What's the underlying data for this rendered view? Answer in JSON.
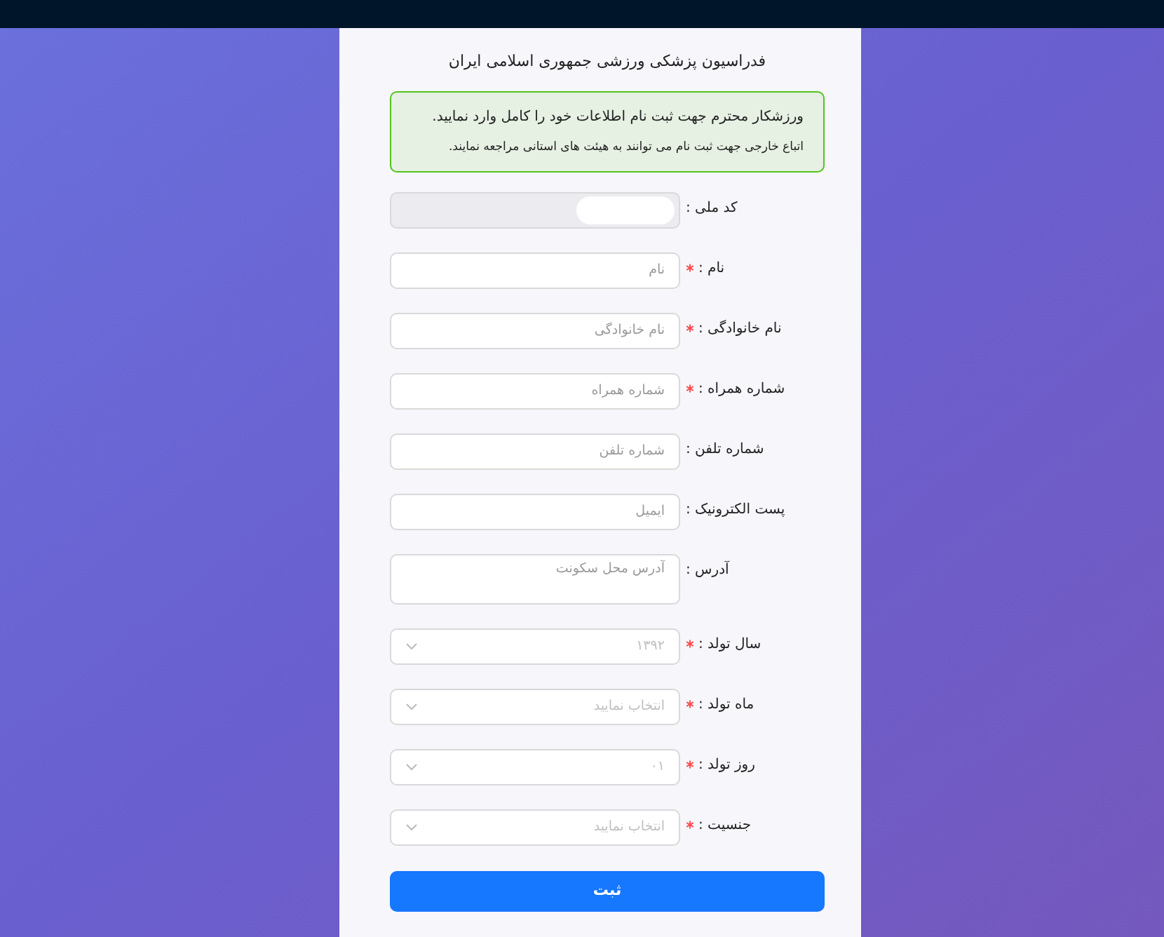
{
  "title": "فدراسیون پزشکی ورزشی جمهوری اسلامی ایران",
  "notice": {
    "lines": [
      "ورزشکار محترم جهت ثبت نام اطلاعات خود را کامل وارد نمایید.",
      "اتباع خارجی جهت ثبت نام می توانند به هیئت های استانی مراجعه نمایند."
    ]
  },
  "fields": [
    {
      "kind": "disabled",
      "label": "کد ملی :",
      "required": false
    },
    {
      "kind": "input",
      "label": "نام :",
      "required": true,
      "placeholder": "نام"
    },
    {
      "kind": "input",
      "label": "نام خانوادگی :",
      "required": true,
      "placeholder": "نام خانوادگی"
    },
    {
      "kind": "input",
      "label": "شماره همراه :",
      "required": true,
      "placeholder": "شماره همراه"
    },
    {
      "kind": "input",
      "label": "شماره تلفن :",
      "required": false,
      "placeholder": "شماره تلفن"
    },
    {
      "kind": "input",
      "label": "پست الکترونیک :",
      "required": false,
      "placeholder": "ایمیل"
    },
    {
      "kind": "textarea",
      "label": "آدرس :",
      "required": false,
      "placeholder": "آدرس محل سکونت"
    },
    {
      "kind": "select",
      "label": "سال تولد :",
      "required": true,
      "placeholder": "۱۳۹۲"
    },
    {
      "kind": "select",
      "label": "ماه تولد :",
      "required": true,
      "placeholder": "انتخاب نمایید"
    },
    {
      "kind": "select",
      "label": "روز تولد :",
      "required": true,
      "placeholder": "۰۱"
    },
    {
      "kind": "select",
      "label": "جنسیت :",
      "required": true,
      "placeholder": "انتخاب نمایید"
    }
  ],
  "submit": {
    "label": "ثبت"
  }
}
